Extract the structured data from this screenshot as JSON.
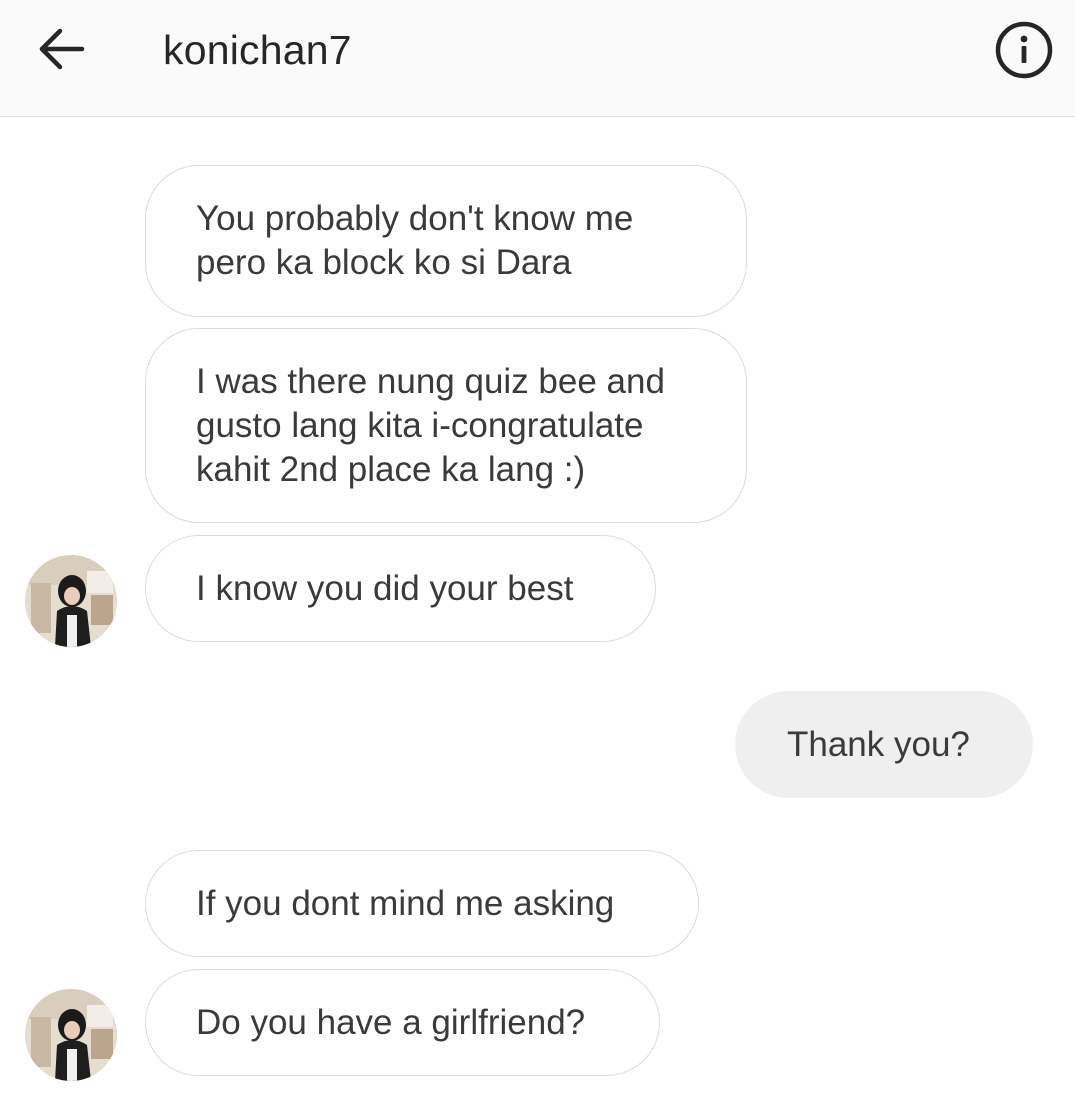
{
  "header": {
    "title": "konichan7",
    "back_icon": "arrow-left-icon",
    "info_icon": "info-circle-icon"
  },
  "messages": [
    {
      "sender": "them",
      "text": "You probably don't know me\npero ka block ko si Dara"
    },
    {
      "sender": "them",
      "text": "I was there nung quiz bee and\ngusto lang kita i-congratulate\nkahit 2nd place ka lang :)"
    },
    {
      "sender": "them",
      "text": "I know you did your best",
      "avatar": true
    },
    {
      "sender": "me",
      "text": "Thank you?"
    },
    {
      "sender": "them",
      "text": "If you dont mind me asking"
    },
    {
      "sender": "them",
      "text": "Do you have a girlfriend?",
      "avatar": true
    }
  ],
  "colors": {
    "header_bg": "#fafafa",
    "incoming_border": "#dbdbdb",
    "outgoing_bg": "#efefef",
    "text": "#262626"
  }
}
